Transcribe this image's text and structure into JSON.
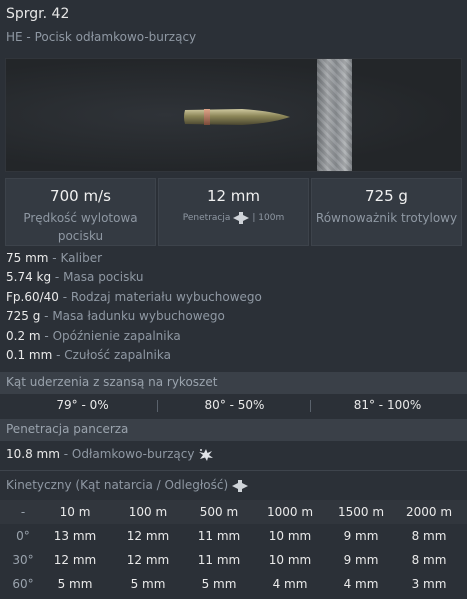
{
  "header": {
    "title": "Sprgr. 42",
    "subtitle": "HE - Pocisk odłamkowo-burzący"
  },
  "stats": {
    "velocity": {
      "value": "700 m/s",
      "label": "Prędkość wylotowa pocisku"
    },
    "penetration": {
      "value": "12 mm",
      "label": "Penetracja",
      "range": "| 100m",
      "icon": "penetration-icon"
    },
    "tnt": {
      "value": "725 g",
      "label": "Równoważnik trotylowy"
    }
  },
  "properties": [
    {
      "value": "75 mm",
      "label": "Kaliber"
    },
    {
      "value": "5.74 kg",
      "label": "Masa pocisku"
    },
    {
      "value": "Fp.60/40",
      "label": "Rodzaj materiału wybuchowego"
    },
    {
      "value": "725 g",
      "label": "Masa ładunku wybuchowego"
    },
    {
      "value": "0.2 m",
      "label": "Opóźnienie zapalnika"
    },
    {
      "value": "0.1 mm",
      "label": "Czułość zapalnika"
    }
  ],
  "ricochet": {
    "title": "Kąt uderzenia z szansą na rykoszet",
    "values": [
      "79° - 0%",
      "80° - 50%",
      "81° - 100%"
    ]
  },
  "armor_pen": {
    "title": "Penetracja pancerza",
    "value": "10.8 mm",
    "label": "Odłamkowo-burzący",
    "icon": "explosion-icon"
  },
  "kinetic": {
    "title": "Kinetyczny (Kąt natarcia / Odległość)",
    "icon": "penetration-icon",
    "columns": [
      "-",
      "10 m",
      "100 m",
      "500 m",
      "1000 m",
      "1500 m",
      "2000 m"
    ],
    "rows": [
      {
        "angle": "0°",
        "values": [
          "13 mm",
          "12 mm",
          "11 mm",
          "10 mm",
          "9 mm",
          "8 mm"
        ]
      },
      {
        "angle": "30°",
        "values": [
          "12 mm",
          "12 mm",
          "11 mm",
          "10 mm",
          "9 mm",
          "8 mm"
        ]
      },
      {
        "angle": "60°",
        "values": [
          "5 mm",
          "5 mm",
          "5 mm",
          "4 mm",
          "4 mm",
          "3 mm"
        ]
      }
    ]
  },
  "colors": {
    "background": "#2b3037",
    "section": "#3a4048",
    "muted_text": "#8f98a3",
    "text": "#eaeaea"
  }
}
